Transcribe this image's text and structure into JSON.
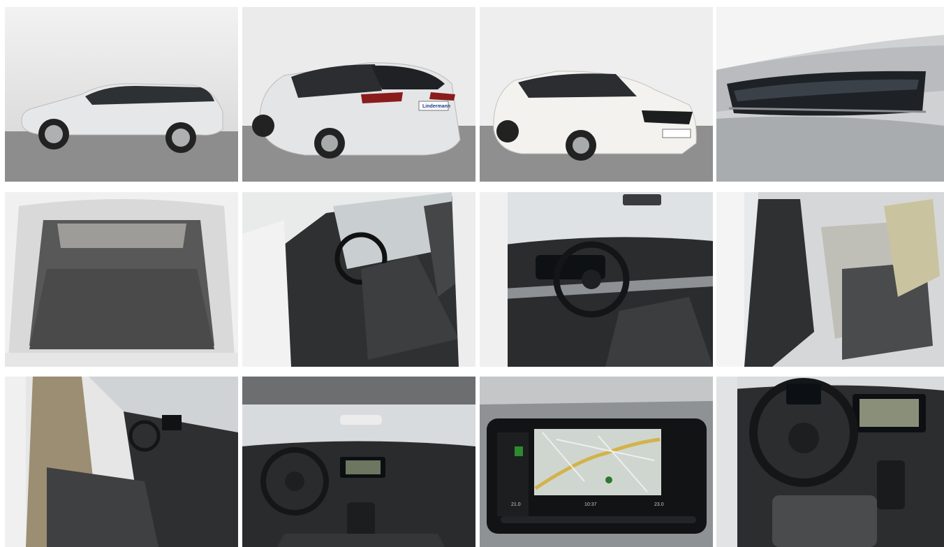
{
  "gallery": {
    "photos": [
      {
        "subject": "side-view"
      },
      {
        "subject": "rear-three-quarter"
      },
      {
        "subject": "front-three-quarter"
      },
      {
        "subject": "headlight-closeup"
      },
      {
        "subject": "trunk"
      },
      {
        "subject": "driver-door-open"
      },
      {
        "subject": "dashboard-driver-side"
      },
      {
        "subject": "rear-seats"
      },
      {
        "subject": "passenger-side-interior"
      },
      {
        "subject": "full-dashboard"
      },
      {
        "subject": "infotainment-navigation"
      },
      {
        "subject": "steering-wheel-cockpit"
      }
    ],
    "dealer_plate": "Lindermann",
    "screen": {
      "temp_left": "21.0",
      "clock": "10:37",
      "temp_right": "23.0"
    }
  },
  "colors": {
    "car_white": "#e8e9ea",
    "interior_dark": "#2a2b2d",
    "backdrop": "#e6e6e6",
    "floor": "#8f8f8f"
  }
}
